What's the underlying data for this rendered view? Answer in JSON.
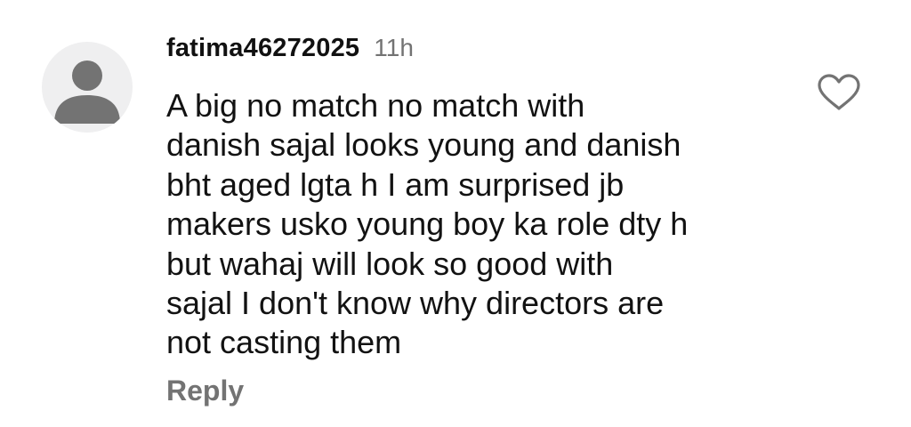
{
  "comment": {
    "username": "fatima46272025",
    "time": "11h",
    "lines": [
      "A big no match no match with",
      "danish sajal looks young and danish",
      "bht aged lgta h I am surprised jb",
      "makers usko young boy ka role dty h",
      "but wahaj will look so good with",
      "sajal I don't know why directors are",
      "not casting them"
    ],
    "reply_label": "Reply",
    "icons": {
      "avatar": "default-avatar-icon",
      "like": "heart-outline-icon"
    }
  },
  "colors": {
    "text": "#121212",
    "muted": "#737373",
    "avatar_bg": "#efeff0",
    "avatar_fg": "#737373"
  }
}
